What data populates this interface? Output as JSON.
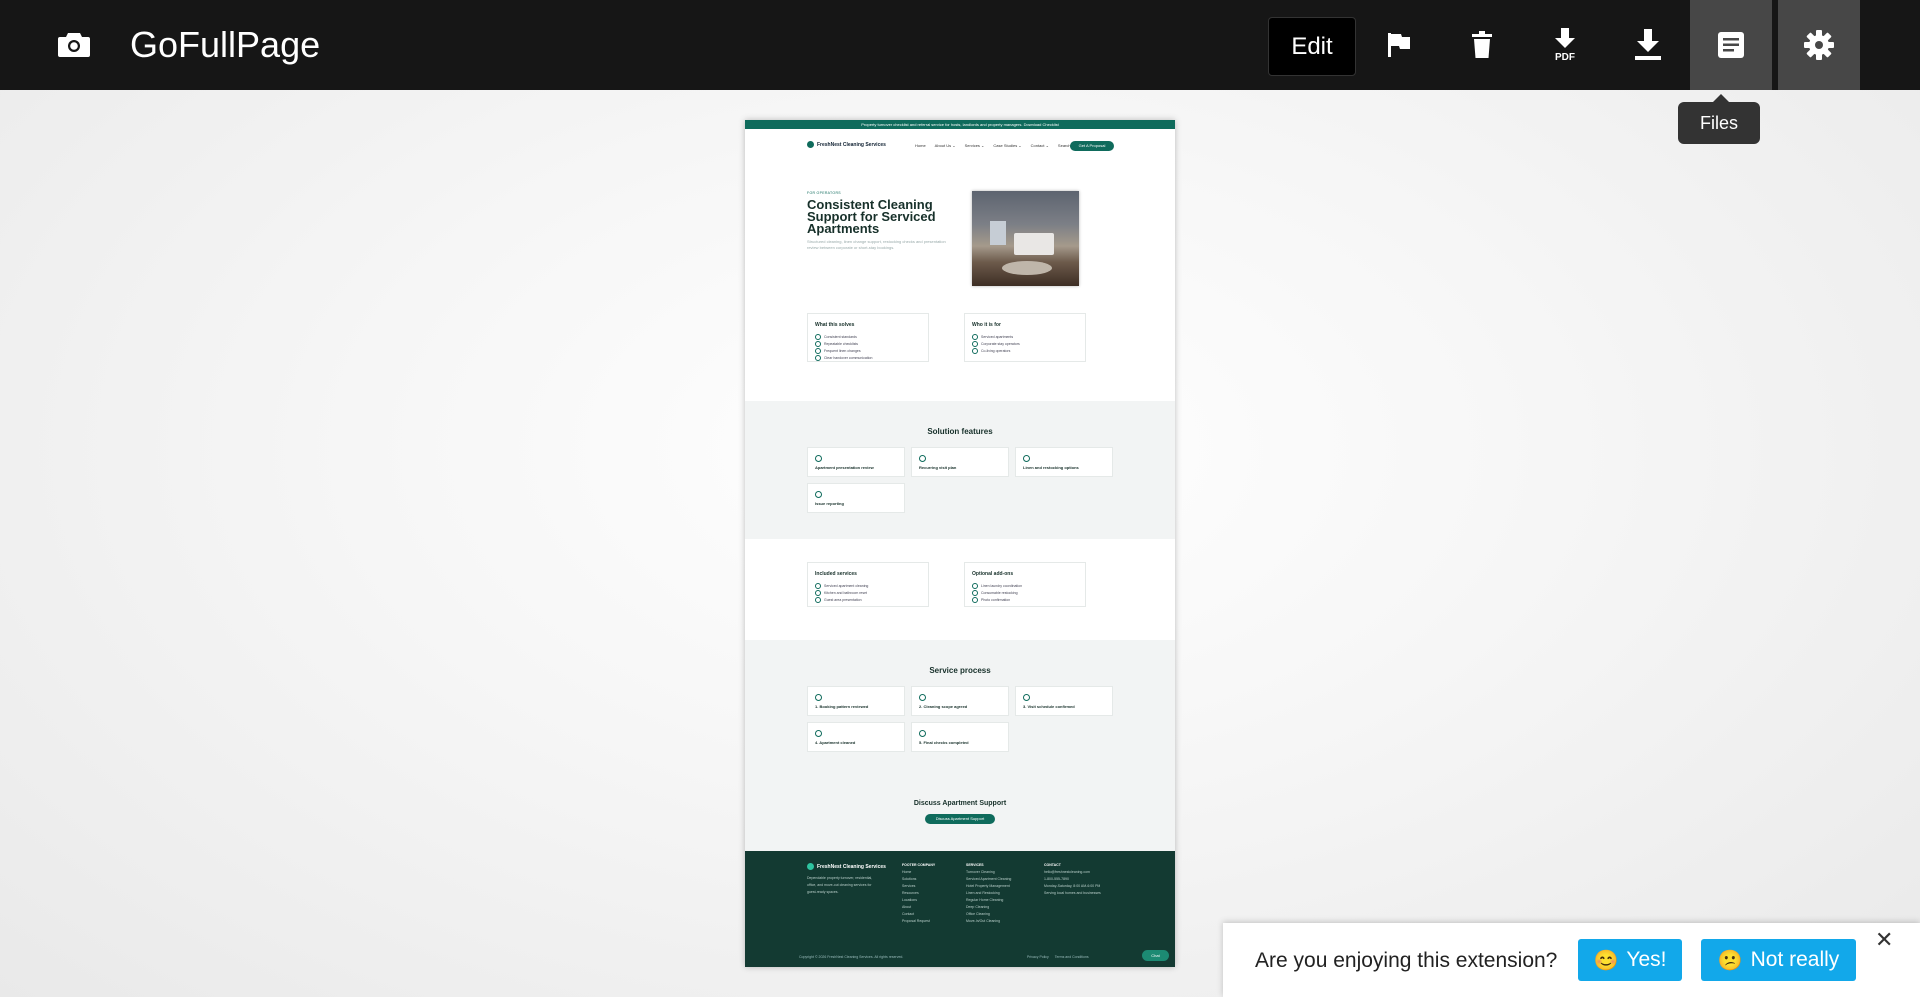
{
  "app": {
    "title": "GoFullPage",
    "toolbar": {
      "edit_label": "Edit",
      "tooltip": "Files"
    }
  },
  "preview_page": {
    "announcement": "Property turnover checklist and referral service for hosts, landlords and property managers. Download Checklist",
    "logo": "FreshNest Cleaning Services",
    "nav": [
      "Home",
      "About Us ⌄",
      "Services ⌄",
      "Case Studies ⌄",
      "Contact ⌄",
      "Search"
    ],
    "nav_cta": "Get A Proposal",
    "kicker": "FOR OPERATORS",
    "heading": "Consistent Cleaning Support for Serviced Apartments",
    "lede": "Structured cleaning, linen change support, restocking checks and presentation review between corporate or short-stay bookings.",
    "what_solves": {
      "title": "What this solves",
      "items": [
        "Consistent standards",
        "Repeatable checklists",
        "Frequent linen changes",
        "Clear handover communication"
      ]
    },
    "who_for": {
      "title": "Who it is for",
      "items": [
        "Serviced apartments",
        "Corporate stay operators",
        "Co-living operators"
      ]
    },
    "solution_features": {
      "title": "Solution features",
      "items": [
        "Apartment presentation review",
        "Recurring visit plan",
        "Linen and restocking options",
        "Issue reporting"
      ]
    },
    "included": {
      "title": "Included services",
      "items": [
        "Serviced apartment cleaning",
        "Kitchen and bathroom reset",
        "Guest area presentation"
      ]
    },
    "addons": {
      "title": "Optional add-ons",
      "items": [
        "Linen laundry coordination",
        "Consumable restocking",
        "Photo confirmation"
      ]
    },
    "process": {
      "title": "Service process",
      "items": [
        "1. Booking pattern reviewed",
        "2. Cleaning scope agreed",
        "3. Visit schedule confirmed",
        "4. Apartment cleaned",
        "5. Final checks completed"
      ]
    },
    "discuss": {
      "title": "Discuss Apartment Support",
      "button": "Discuss Apartment Support"
    },
    "footer": {
      "logo": "FreshNest Cleaning Services",
      "blurb": "Dependable property turnover, residential, office, and move-out cleaning services for guest-ready spaces.",
      "col1_title": "FOOTER COMPANY",
      "col1": [
        "Home",
        "Solutions",
        "Services",
        "Resources",
        "Locations",
        "About",
        "Contact",
        "Proposal Request"
      ],
      "col2_title": "SERVICES",
      "col2": [
        "Turnover Cleaning",
        "Serviced Apartment Cleaning",
        "Hotel Property Management",
        "Linen and Restocking",
        "Regular Home Cleaning",
        "Deep Cleaning",
        "Office Cleaning",
        "Move-In/Out Cleaning"
      ],
      "col3_title": "CONTACT",
      "col3": [
        "hello@freshnestcleaning.com",
        "1-800-555-7890",
        "Monday-Saturday, 8:00 AM-6:00 PM",
        "Serving local homes and businesses"
      ],
      "copyright": "Copyright © 2026 FreshNest Cleaning Services. All rights reserved.",
      "legal": [
        "Privacy Policy",
        "Terms and Conditions"
      ],
      "chat": "Chat"
    }
  },
  "feedback": {
    "question": "Are you enjoying this extension?",
    "yes_label": "Yes!",
    "no_label": "Not really",
    "yes_emoji": "😊",
    "no_emoji": "😕"
  },
  "colors": {
    "topbar": "#161616",
    "active_tab": "#474747",
    "brand_green": "#0f6b5c",
    "footer_green": "#133a32",
    "feedback_button": "#12a8ea"
  }
}
